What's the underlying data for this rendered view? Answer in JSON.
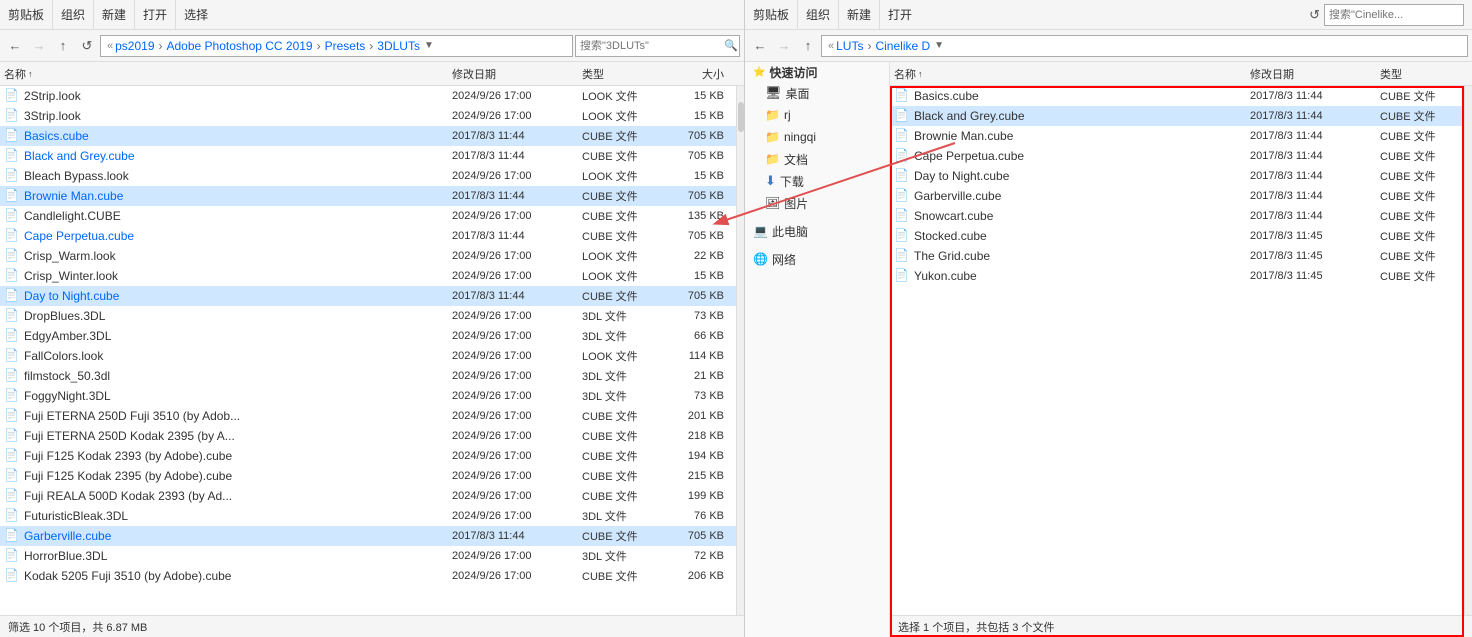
{
  "left": {
    "toolbar": {
      "clipboard": "剪贴板",
      "organize": "组织",
      "new": "新建",
      "open": "打开",
      "select": "选择"
    },
    "breadcrumb": {
      "parts": [
        "ps2019",
        "Adobe Photoshop CC 2019",
        "Presets",
        "3DLUTs"
      ],
      "search_placeholder": "搜索\"3DLUTs\""
    },
    "columns": {
      "name": "名称",
      "sort_arrow": "↑",
      "date": "修改日期",
      "type": "类型",
      "size": "大小"
    },
    "files": [
      {
        "name": "2Strip.look",
        "date": "2024/9/26 17:00",
        "type": "LOOK 文件",
        "size": "15 KB",
        "highlight": false,
        "isBlue": false
      },
      {
        "name": "3Strip.look",
        "date": "2024/9/26 17:00",
        "type": "LOOK 文件",
        "size": "15 KB",
        "highlight": false,
        "isBlue": false
      },
      {
        "name": "Basics.cube",
        "date": "2017/8/3 11:44",
        "type": "CUBE 文件",
        "size": "705 KB",
        "highlight": true,
        "isBlue": true
      },
      {
        "name": "Black and Grey.cube",
        "date": "2017/8/3 11:44",
        "type": "CUBE 文件",
        "size": "705 KB",
        "highlight": false,
        "isBlue": true
      },
      {
        "name": "Bleach Bypass.look",
        "date": "2024/9/26 17:00",
        "type": "LOOK 文件",
        "size": "15 KB",
        "highlight": false,
        "isBlue": false
      },
      {
        "name": "Brownie Man.cube",
        "date": "2017/8/3 11:44",
        "type": "CUBE 文件",
        "size": "705 KB",
        "highlight": true,
        "isBlue": true
      },
      {
        "name": "Candlelight.CUBE",
        "date": "2024/9/26 17:00",
        "type": "CUBE 文件",
        "size": "135 KB",
        "highlight": false,
        "isBlue": false
      },
      {
        "name": "Cape Perpetua.cube",
        "date": "2017/8/3 11:44",
        "type": "CUBE 文件",
        "size": "705 KB",
        "highlight": false,
        "isBlue": true
      },
      {
        "name": "Crisp_Warm.look",
        "date": "2024/9/26 17:00",
        "type": "LOOK 文件",
        "size": "22 KB",
        "highlight": false,
        "isBlue": false
      },
      {
        "name": "Crisp_Winter.look",
        "date": "2024/9/26 17:00",
        "type": "LOOK 文件",
        "size": "15 KB",
        "highlight": false,
        "isBlue": false
      },
      {
        "name": "Day to Night.cube",
        "date": "2017/8/3 11:44",
        "type": "CUBE 文件",
        "size": "705 KB",
        "highlight": true,
        "isBlue": true
      },
      {
        "name": "DropBlues.3DL",
        "date": "2024/9/26 17:00",
        "type": "3DL 文件",
        "size": "73 KB",
        "highlight": false,
        "isBlue": false
      },
      {
        "name": "EdgyAmber.3DL",
        "date": "2024/9/26 17:00",
        "type": "3DL 文件",
        "size": "66 KB",
        "highlight": false,
        "isBlue": false
      },
      {
        "name": "FallColors.look",
        "date": "2024/9/26 17:00",
        "type": "LOOK 文件",
        "size": "114 KB",
        "highlight": false,
        "isBlue": false
      },
      {
        "name": "filmstock_50.3dl",
        "date": "2024/9/26 17:00",
        "type": "3DL 文件",
        "size": "21 KB",
        "highlight": false,
        "isBlue": false
      },
      {
        "name": "FoggyNight.3DL",
        "date": "2024/9/26 17:00",
        "type": "3DL 文件",
        "size": "73 KB",
        "highlight": false,
        "isBlue": false
      },
      {
        "name": "Fuji ETERNA 250D Fuji 3510 (by Adob...",
        "date": "2024/9/26 17:00",
        "type": "CUBE 文件",
        "size": "201 KB",
        "highlight": false,
        "isBlue": false
      },
      {
        "name": "Fuji ETERNA 250D Kodak 2395 (by A...",
        "date": "2024/9/26 17:00",
        "type": "CUBE 文件",
        "size": "218 KB",
        "highlight": false,
        "isBlue": false
      },
      {
        "name": "Fuji F125 Kodak 2393 (by Adobe).cube",
        "date": "2024/9/26 17:00",
        "type": "CUBE 文件",
        "size": "194 KB",
        "highlight": false,
        "isBlue": false
      },
      {
        "name": "Fuji F125 Kodak 2395 (by Adobe).cube",
        "date": "2024/9/26 17:00",
        "type": "CUBE 文件",
        "size": "215 KB",
        "highlight": false,
        "isBlue": false
      },
      {
        "name": "Fuji REALA 500D Kodak 2393 (by Ad...",
        "date": "2024/9/26 17:00",
        "type": "CUBE 文件",
        "size": "199 KB",
        "highlight": false,
        "isBlue": false
      },
      {
        "name": "FuturisticBleak.3DL",
        "date": "2024/9/26 17:00",
        "type": "3DL 文件",
        "size": "76 KB",
        "highlight": false,
        "isBlue": false
      },
      {
        "name": "Garberville.cube",
        "date": "2017/8/3 11:44",
        "type": "CUBE 文件",
        "size": "705 KB",
        "highlight": true,
        "isBlue": true
      },
      {
        "name": "HorrorBlue.3DL",
        "date": "2024/9/26 17:00",
        "type": "3DL 文件",
        "size": "72 KB",
        "highlight": false,
        "isBlue": false
      },
      {
        "name": "Kodak 5205 Fuji 3510 (by Adobe).cube",
        "date": "2024/9/26 17:00",
        "type": "CUBE 文件",
        "size": "206 KB",
        "highlight": false,
        "isBlue": false
      }
    ],
    "status": "筛选 10 个项目，共 6.87 MB"
  },
  "right": {
    "toolbar": {
      "clipboard": "剪贴板",
      "organize": "组织",
      "new": "新建",
      "open": "打开"
    },
    "breadcrumb": {
      "parts": [
        "LUTs",
        "Cinelike D"
      ],
      "search_placeholder": "搜索\"Cinelike..."
    },
    "columns": {
      "name": "名称",
      "sort_arrow": "↑",
      "date": "修改日期",
      "type": "类型"
    },
    "sidebar": {
      "items": [
        {
          "label": "快速访问",
          "type": "header"
        },
        {
          "label": "桌面",
          "type": "folder",
          "icon": "desktop"
        },
        {
          "label": "rj",
          "type": "folder"
        },
        {
          "label": "ningqi",
          "type": "folder"
        },
        {
          "label": "文档",
          "type": "folder"
        },
        {
          "label": "下载",
          "type": "folder"
        },
        {
          "label": "图片",
          "type": "folder"
        },
        {
          "label": "此电脑",
          "type": "special"
        },
        {
          "label": "网络",
          "type": "special"
        }
      ]
    },
    "files": [
      {
        "name": "Basics.cube",
        "date": "2017/8/3 11:44",
        "type": "CUBE 文件",
        "highlight": false
      },
      {
        "name": "Black and Grey.cube",
        "date": "2017/8/3 11:44",
        "type": "CUBE 文件",
        "highlight": true
      },
      {
        "name": "Brownie Man.cube",
        "date": "2017/8/3 11:44",
        "type": "CUBE 文件",
        "highlight": false
      },
      {
        "name": "Cape Perpetua.cube",
        "date": "2017/8/3 11:44",
        "type": "CUBE 文件",
        "highlight": false
      },
      {
        "name": "Day to Night.cube",
        "date": "2017/8/3 11:44",
        "type": "CUBE 文件",
        "highlight": false
      },
      {
        "name": "Garberville.cube",
        "date": "2017/8/3 11:44",
        "type": "CUBE 文件",
        "highlight": false
      },
      {
        "name": "Snowcart.cube",
        "date": "2017/8/3 11:44",
        "type": "CUBE 文件",
        "highlight": false
      },
      {
        "name": "Stocked.cube",
        "date": "2017/8/3 11:45",
        "type": "CUBE 文件",
        "highlight": false
      },
      {
        "name": "The Grid.cube",
        "date": "2017/8/3 11:45",
        "type": "CUBE 文件",
        "highlight": false
      },
      {
        "name": "Yukon.cube",
        "date": "2017/8/3 11:45",
        "type": "CUBE 文件",
        "highlight": false
      }
    ],
    "status": "选择 1 个项目，共包括 3 个文件"
  },
  "icons": {
    "back": "←",
    "forward": "→",
    "up": "↑",
    "refresh": "↺",
    "search": "🔍",
    "folder_yellow": "📁",
    "file_white": "📄",
    "desktop": "🖥",
    "download": "⬇",
    "picture": "🖼",
    "computer": "💻",
    "network": "🌐",
    "pin": "📌"
  }
}
